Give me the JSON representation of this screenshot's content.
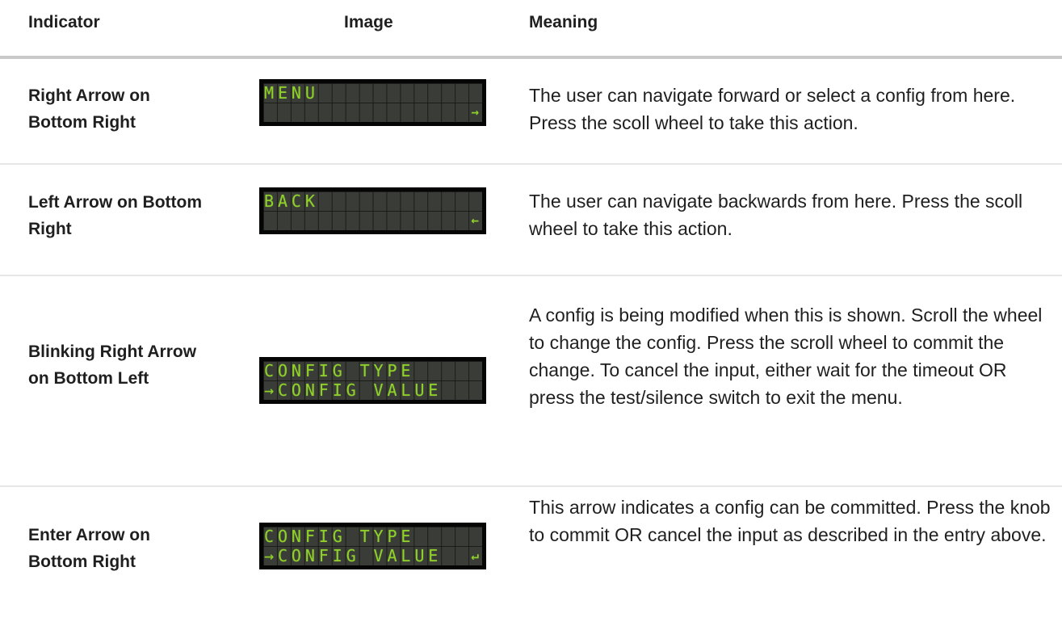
{
  "header": {
    "indicator": "Indicator",
    "image": "Image",
    "meaning": "Meaning"
  },
  "rows": [
    {
      "indicator": "Right Arrow on Bottom Right",
      "lcd_line1": "MENU",
      "lcd_line2": "",
      "lcd_symbol": "→",
      "meaning": "The user can navigate forward or select a config from here. Press the scoll wheel to take this action."
    },
    {
      "indicator": "Left Arrow on Bottom Right",
      "lcd_line1": "BACK",
      "lcd_line2": "",
      "lcd_symbol": "←",
      "meaning": "The user can navigate backwards from here. Press the scoll wheel to take this action."
    },
    {
      "indicator": "Blinking Right Arrow on Bottom Left",
      "lcd_line1": "CONFIG TYPE",
      "lcd_line2": "→CONFIG VALUE",
      "lcd_symbol": "",
      "meaning": "A config is being modified when this is shown. Scroll the wheel to change the config. Press the scroll wheel to commit the change. To cancel the input, either wait for the timeout OR press the test/silence switch to exit the menu."
    },
    {
      "indicator": "Enter Arrow on Bottom Right",
      "lcd_line1": "CONFIG TYPE",
      "lcd_line2": "→CONFIG VALUE",
      "lcd_symbol": "↵",
      "meaning": "This arrow indicates a config can be committed. Press the knob to commit OR cancel the input as described in the entry above."
    }
  ],
  "colors": {
    "lcd_text": "#8fd12a",
    "lcd_background": "#3a3c37",
    "lcd_border": "#050505",
    "header_rule": "#c9c9c9",
    "row_rule": "#e6e6e6"
  }
}
